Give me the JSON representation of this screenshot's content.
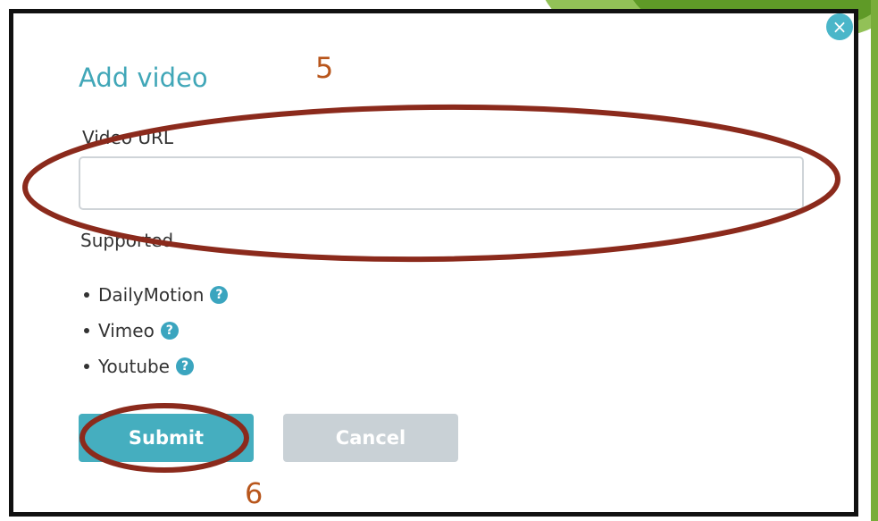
{
  "dialog": {
    "title": "Add video",
    "close_icon": "×",
    "url_label": "Video URL",
    "url_value": "",
    "url_placeholder": "",
    "supported_label": "Supported",
    "providers": [
      {
        "name": "DailyMotion",
        "help_icon": "?"
      },
      {
        "name": "Vimeo",
        "help_icon": "?"
      },
      {
        "name": "Youtube",
        "help_icon": "?"
      }
    ],
    "submit_label": "Submit",
    "cancel_label": "Cancel"
  },
  "annotations": {
    "step_url": "5",
    "step_submit": "6",
    "color": "#8b2a1c"
  },
  "colors": {
    "accent": "#41a7b8",
    "submit_bg": "#45aebf",
    "cancel_bg": "#c9d1d6",
    "border": "#111111"
  }
}
